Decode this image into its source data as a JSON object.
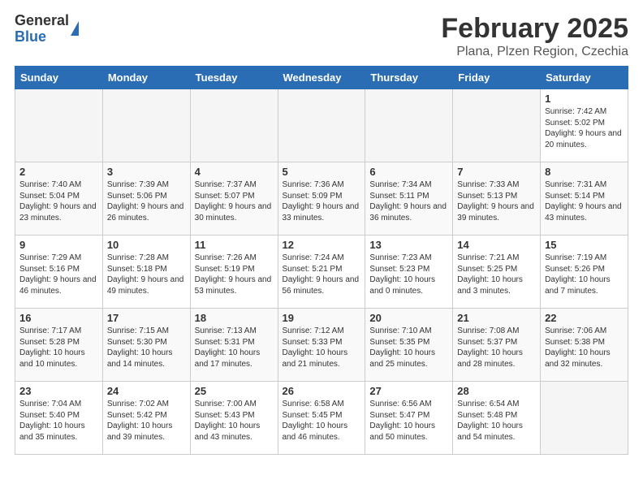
{
  "header": {
    "logo_general": "General",
    "logo_blue": "Blue",
    "title": "February 2025",
    "location": "Plana, Plzen Region, Czechia"
  },
  "days_of_week": [
    "Sunday",
    "Monday",
    "Tuesday",
    "Wednesday",
    "Thursday",
    "Friday",
    "Saturday"
  ],
  "weeks": [
    [
      {
        "day": "",
        "info": ""
      },
      {
        "day": "",
        "info": ""
      },
      {
        "day": "",
        "info": ""
      },
      {
        "day": "",
        "info": ""
      },
      {
        "day": "",
        "info": ""
      },
      {
        "day": "",
        "info": ""
      },
      {
        "day": "1",
        "info": "Sunrise: 7:42 AM\nSunset: 5:02 PM\nDaylight: 9 hours and 20 minutes."
      }
    ],
    [
      {
        "day": "2",
        "info": "Sunrise: 7:40 AM\nSunset: 5:04 PM\nDaylight: 9 hours and 23 minutes."
      },
      {
        "day": "3",
        "info": "Sunrise: 7:39 AM\nSunset: 5:06 PM\nDaylight: 9 hours and 26 minutes."
      },
      {
        "day": "4",
        "info": "Sunrise: 7:37 AM\nSunset: 5:07 PM\nDaylight: 9 hours and 30 minutes."
      },
      {
        "day": "5",
        "info": "Sunrise: 7:36 AM\nSunset: 5:09 PM\nDaylight: 9 hours and 33 minutes."
      },
      {
        "day": "6",
        "info": "Sunrise: 7:34 AM\nSunset: 5:11 PM\nDaylight: 9 hours and 36 minutes."
      },
      {
        "day": "7",
        "info": "Sunrise: 7:33 AM\nSunset: 5:13 PM\nDaylight: 9 hours and 39 minutes."
      },
      {
        "day": "8",
        "info": "Sunrise: 7:31 AM\nSunset: 5:14 PM\nDaylight: 9 hours and 43 minutes."
      }
    ],
    [
      {
        "day": "9",
        "info": "Sunrise: 7:29 AM\nSunset: 5:16 PM\nDaylight: 9 hours and 46 minutes."
      },
      {
        "day": "10",
        "info": "Sunrise: 7:28 AM\nSunset: 5:18 PM\nDaylight: 9 hours and 49 minutes."
      },
      {
        "day": "11",
        "info": "Sunrise: 7:26 AM\nSunset: 5:19 PM\nDaylight: 9 hours and 53 minutes."
      },
      {
        "day": "12",
        "info": "Sunrise: 7:24 AM\nSunset: 5:21 PM\nDaylight: 9 hours and 56 minutes."
      },
      {
        "day": "13",
        "info": "Sunrise: 7:23 AM\nSunset: 5:23 PM\nDaylight: 10 hours and 0 minutes."
      },
      {
        "day": "14",
        "info": "Sunrise: 7:21 AM\nSunset: 5:25 PM\nDaylight: 10 hours and 3 minutes."
      },
      {
        "day": "15",
        "info": "Sunrise: 7:19 AM\nSunset: 5:26 PM\nDaylight: 10 hours and 7 minutes."
      }
    ],
    [
      {
        "day": "16",
        "info": "Sunrise: 7:17 AM\nSunset: 5:28 PM\nDaylight: 10 hours and 10 minutes."
      },
      {
        "day": "17",
        "info": "Sunrise: 7:15 AM\nSunset: 5:30 PM\nDaylight: 10 hours and 14 minutes."
      },
      {
        "day": "18",
        "info": "Sunrise: 7:13 AM\nSunset: 5:31 PM\nDaylight: 10 hours and 17 minutes."
      },
      {
        "day": "19",
        "info": "Sunrise: 7:12 AM\nSunset: 5:33 PM\nDaylight: 10 hours and 21 minutes."
      },
      {
        "day": "20",
        "info": "Sunrise: 7:10 AM\nSunset: 5:35 PM\nDaylight: 10 hours and 25 minutes."
      },
      {
        "day": "21",
        "info": "Sunrise: 7:08 AM\nSunset: 5:37 PM\nDaylight: 10 hours and 28 minutes."
      },
      {
        "day": "22",
        "info": "Sunrise: 7:06 AM\nSunset: 5:38 PM\nDaylight: 10 hours and 32 minutes."
      }
    ],
    [
      {
        "day": "23",
        "info": "Sunrise: 7:04 AM\nSunset: 5:40 PM\nDaylight: 10 hours and 35 minutes."
      },
      {
        "day": "24",
        "info": "Sunrise: 7:02 AM\nSunset: 5:42 PM\nDaylight: 10 hours and 39 minutes."
      },
      {
        "day": "25",
        "info": "Sunrise: 7:00 AM\nSunset: 5:43 PM\nDaylight: 10 hours and 43 minutes."
      },
      {
        "day": "26",
        "info": "Sunrise: 6:58 AM\nSunset: 5:45 PM\nDaylight: 10 hours and 46 minutes."
      },
      {
        "day": "27",
        "info": "Sunrise: 6:56 AM\nSunset: 5:47 PM\nDaylight: 10 hours and 50 minutes."
      },
      {
        "day": "28",
        "info": "Sunrise: 6:54 AM\nSunset: 5:48 PM\nDaylight: 10 hours and 54 minutes."
      },
      {
        "day": "",
        "info": ""
      }
    ]
  ]
}
